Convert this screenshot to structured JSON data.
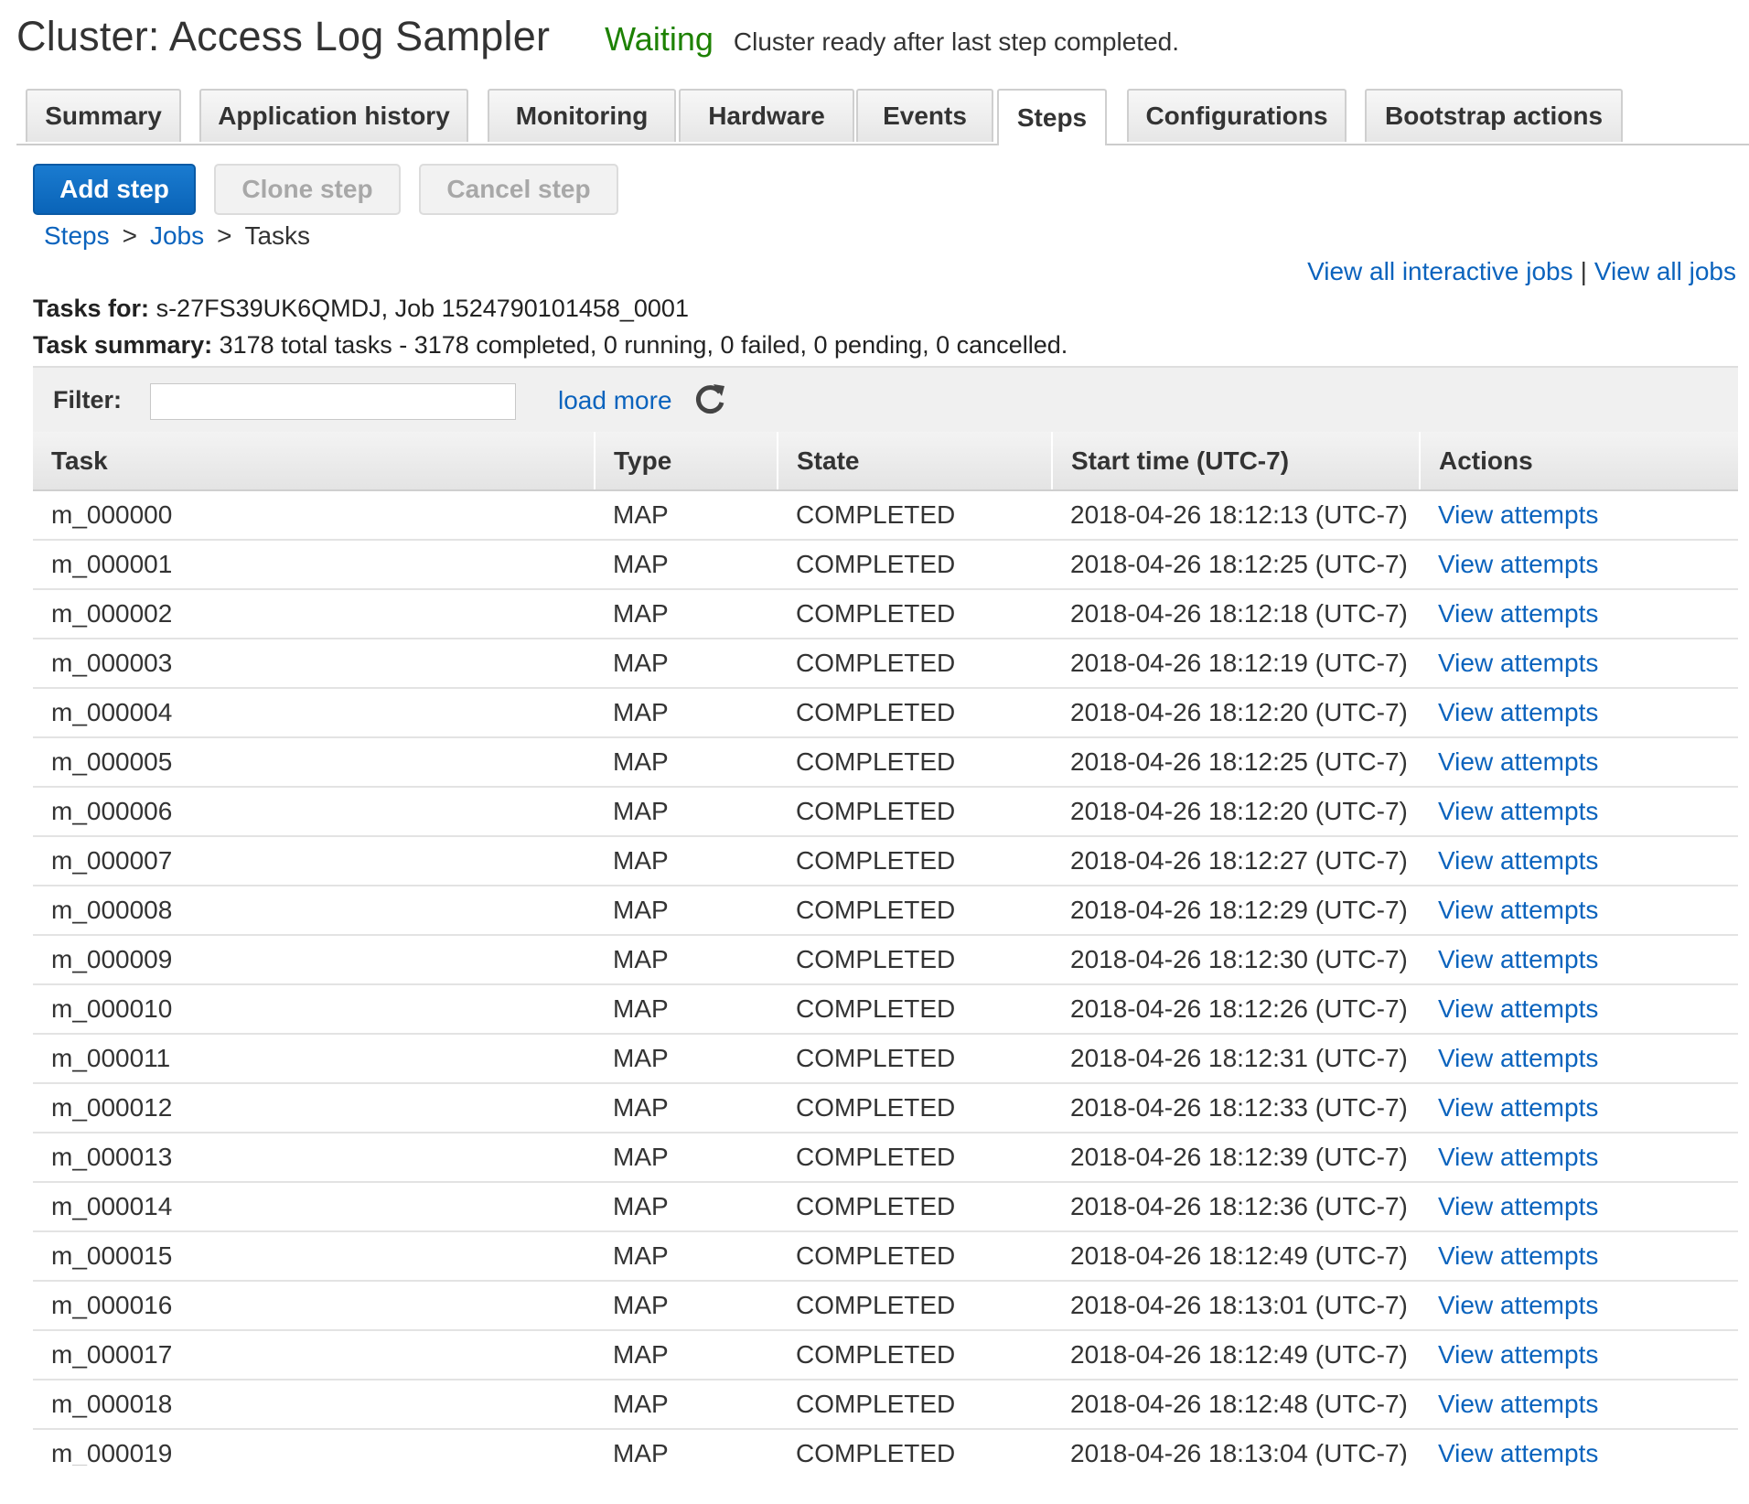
{
  "header": {
    "cluster_title": "Cluster: Access Log Sampler",
    "status": "Waiting",
    "status_message": "Cluster ready after last step completed.",
    "status_color": "#1d8102"
  },
  "tabs": [
    {
      "label": "Summary",
      "active": false
    },
    {
      "label": "Application history",
      "active": false
    },
    {
      "label": "Monitoring",
      "active": false
    },
    {
      "label": "Hardware",
      "active": false
    },
    {
      "label": "Events",
      "active": false
    },
    {
      "label": "Steps",
      "active": true
    },
    {
      "label": "Configurations",
      "active": false
    },
    {
      "label": "Bootstrap actions",
      "active": false
    }
  ],
  "buttons": {
    "add_step": "Add step",
    "clone_step": "Clone step",
    "cancel_step": "Cancel step"
  },
  "breadcrumb": {
    "steps": "Steps",
    "jobs": "Jobs",
    "tasks": "Tasks",
    "separator": ">"
  },
  "links": {
    "view_interactive_jobs": "View all interactive jobs",
    "separator": "|",
    "view_all_jobs": "View all jobs"
  },
  "tasks_for": {
    "label": "Tasks for:",
    "value": "s-27FS39UK6QMDJ, Job 1524790101458_0001"
  },
  "task_summary": {
    "label": "Task summary:",
    "value": "3178 total tasks - 3178 completed, 0 running, 0 failed, 0 pending, 0 cancelled."
  },
  "filter": {
    "label": "Filter:",
    "value": "",
    "placeholder": "",
    "load_more": "load more",
    "refresh_icon": "refresh-icon"
  },
  "table": {
    "headers": [
      "Task",
      "Type",
      "State",
      "Start time (UTC-7)",
      "Actions"
    ],
    "rows": [
      {
        "task": "m_000000",
        "type": "MAP",
        "state": "COMPLETED",
        "start": "2018-04-26 18:12:13 (UTC-7)",
        "action": "View attempts"
      },
      {
        "task": "m_000001",
        "type": "MAP",
        "state": "COMPLETED",
        "start": "2018-04-26 18:12:25 (UTC-7)",
        "action": "View attempts"
      },
      {
        "task": "m_000002",
        "type": "MAP",
        "state": "COMPLETED",
        "start": "2018-04-26 18:12:18 (UTC-7)",
        "action": "View attempts"
      },
      {
        "task": "m_000003",
        "type": "MAP",
        "state": "COMPLETED",
        "start": "2018-04-26 18:12:19 (UTC-7)",
        "action": "View attempts"
      },
      {
        "task": "m_000004",
        "type": "MAP",
        "state": "COMPLETED",
        "start": "2018-04-26 18:12:20 (UTC-7)",
        "action": "View attempts"
      },
      {
        "task": "m_000005",
        "type": "MAP",
        "state": "COMPLETED",
        "start": "2018-04-26 18:12:25 (UTC-7)",
        "action": "View attempts"
      },
      {
        "task": "m_000006",
        "type": "MAP",
        "state": "COMPLETED",
        "start": "2018-04-26 18:12:20 (UTC-7)",
        "action": "View attempts"
      },
      {
        "task": "m_000007",
        "type": "MAP",
        "state": "COMPLETED",
        "start": "2018-04-26 18:12:27 (UTC-7)",
        "action": "View attempts"
      },
      {
        "task": "m_000008",
        "type": "MAP",
        "state": "COMPLETED",
        "start": "2018-04-26 18:12:29 (UTC-7)",
        "action": "View attempts"
      },
      {
        "task": "m_000009",
        "type": "MAP",
        "state": "COMPLETED",
        "start": "2018-04-26 18:12:30 (UTC-7)",
        "action": "View attempts"
      },
      {
        "task": "m_000010",
        "type": "MAP",
        "state": "COMPLETED",
        "start": "2018-04-26 18:12:26 (UTC-7)",
        "action": "View attempts"
      },
      {
        "task": "m_000011",
        "type": "MAP",
        "state": "COMPLETED",
        "start": "2018-04-26 18:12:31 (UTC-7)",
        "action": "View attempts"
      },
      {
        "task": "m_000012",
        "type": "MAP",
        "state": "COMPLETED",
        "start": "2018-04-26 18:12:33 (UTC-7)",
        "action": "View attempts"
      },
      {
        "task": "m_000013",
        "type": "MAP",
        "state": "COMPLETED",
        "start": "2018-04-26 18:12:39 (UTC-7)",
        "action": "View attempts"
      },
      {
        "task": "m_000014",
        "type": "MAP",
        "state": "COMPLETED",
        "start": "2018-04-26 18:12:36 (UTC-7)",
        "action": "View attempts"
      },
      {
        "task": "m_000015",
        "type": "MAP",
        "state": "COMPLETED",
        "start": "2018-04-26 18:12:49 (UTC-7)",
        "action": "View attempts"
      },
      {
        "task": "m_000016",
        "type": "MAP",
        "state": "COMPLETED",
        "start": "2018-04-26 18:13:01 (UTC-7)",
        "action": "View attempts"
      },
      {
        "task": "m_000017",
        "type": "MAP",
        "state": "COMPLETED",
        "start": "2018-04-26 18:12:49 (UTC-7)",
        "action": "View attempts"
      },
      {
        "task": "m_000018",
        "type": "MAP",
        "state": "COMPLETED",
        "start": "2018-04-26 18:12:48 (UTC-7)",
        "action": "View attempts"
      },
      {
        "task": "m_000019",
        "type": "MAP",
        "state": "COMPLETED",
        "start": "2018-04-26 18:13:04 (UTC-7)",
        "action": "View attempts"
      }
    ]
  },
  "colors": {
    "link": "#0b63bd",
    "primary_button": "#0a64b8",
    "status_waiting": "#1d8102"
  }
}
